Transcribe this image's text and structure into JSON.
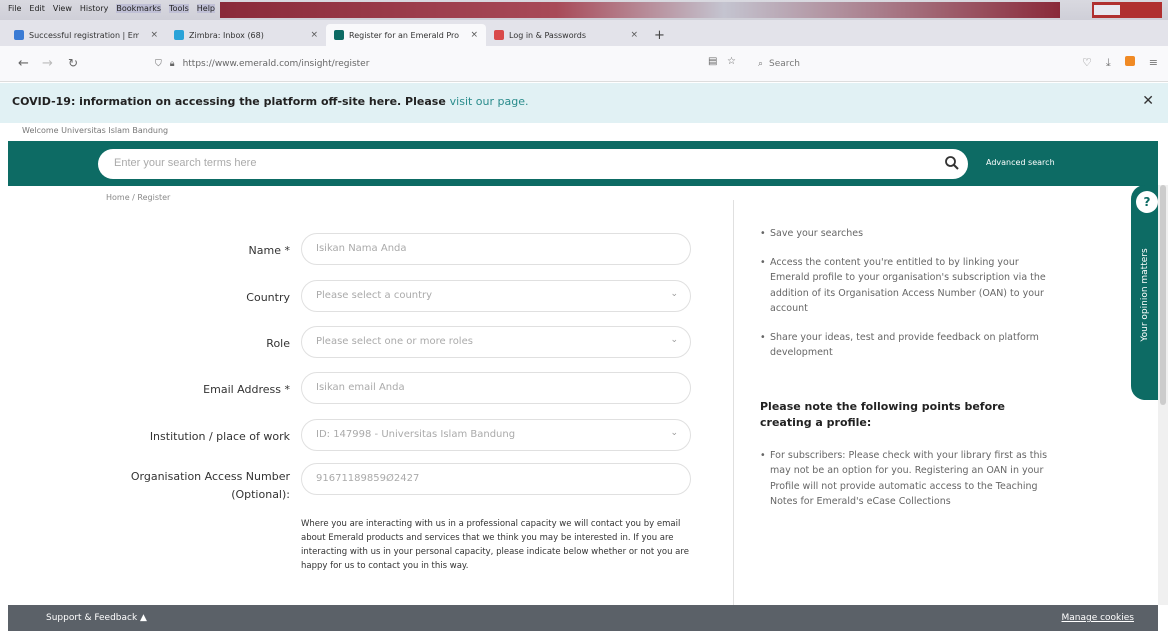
{
  "browser": {
    "menu_items": [
      "File",
      "Edit",
      "View",
      "History",
      "Bookmarks",
      "Tools",
      "Help"
    ],
    "tabs": [
      {
        "label": "Successful registration | Emera",
        "active": false,
        "color": "#3b7bd4"
      },
      {
        "label": "Zimbra: Inbox (68)",
        "active": false,
        "color": "#2aa3d8"
      },
      {
        "label": "Register for an Emerald Profile",
        "active": true,
        "color": "#0d6b64"
      },
      {
        "label": "Log in & Passwords",
        "active": false,
        "color": "#d94a4a"
      }
    ],
    "new_tab": "+",
    "url": "https://www.emerald.com/insight/register",
    "search_placeholder": "Search"
  },
  "banner": {
    "text": "COVID-19: information on accessing the platform off-site here. Please",
    "link": "visit our page.",
    "close": "✕"
  },
  "welcome": "Welcome Universitas Islam Bandung",
  "search": {
    "placeholder": "Enter your search terms here",
    "advanced": "Advanced search"
  },
  "breadcrumb": "Home / Register",
  "form": {
    "name_label": "Name *",
    "name_placeholder": "Isikan Nama Anda",
    "country_label": "Country",
    "country_value": "Please select a country",
    "role_label": "Role",
    "role_value": "Please select one or more roles",
    "email_label": "Email Address *",
    "email_placeholder": "Isikan email Anda",
    "institution_label": "Institution / place of work",
    "institution_value": "ID: 147998 - Universitas Islam Bandung",
    "oan_label_1": "Organisation Access Number",
    "oan_label_2": "(Optional):",
    "oan_value": "91671189859Ø2427",
    "consent": "Where you are interacting with us in a professional capacity we will contact you by email about Emerald products and services that we think you may be interested in. If you are interacting with us in your personal capacity, please indicate below whether or not you are happy for us to contact you in this way."
  },
  "right_col": {
    "bullets": [
      "Save your searches",
      "Access the content you're entitled to by linking your Emerald profile to your organisation's subscription via the addition of its Organisation Access Number (OAN) to your account",
      "Share your ideas, test and provide feedback on platform development"
    ],
    "note_heading": "Please note the following points before creating a profile:",
    "note_bullets": [
      "For subscribers: Please check with your library first as this may not be an option for you. Registering an OAN in your Profile will not provide automatic access to the Teaching Notes for Emerald's eCase Collections"
    ]
  },
  "feedback_tab": {
    "label": "Your opinion matters",
    "icon": "?"
  },
  "footer": {
    "support": "Support & Feedback ▲",
    "cookies": "Manage cookies"
  },
  "colors": {
    "brand": "#0d6b64",
    "banner": "#e1f1f4",
    "footer": "#5b6168"
  }
}
